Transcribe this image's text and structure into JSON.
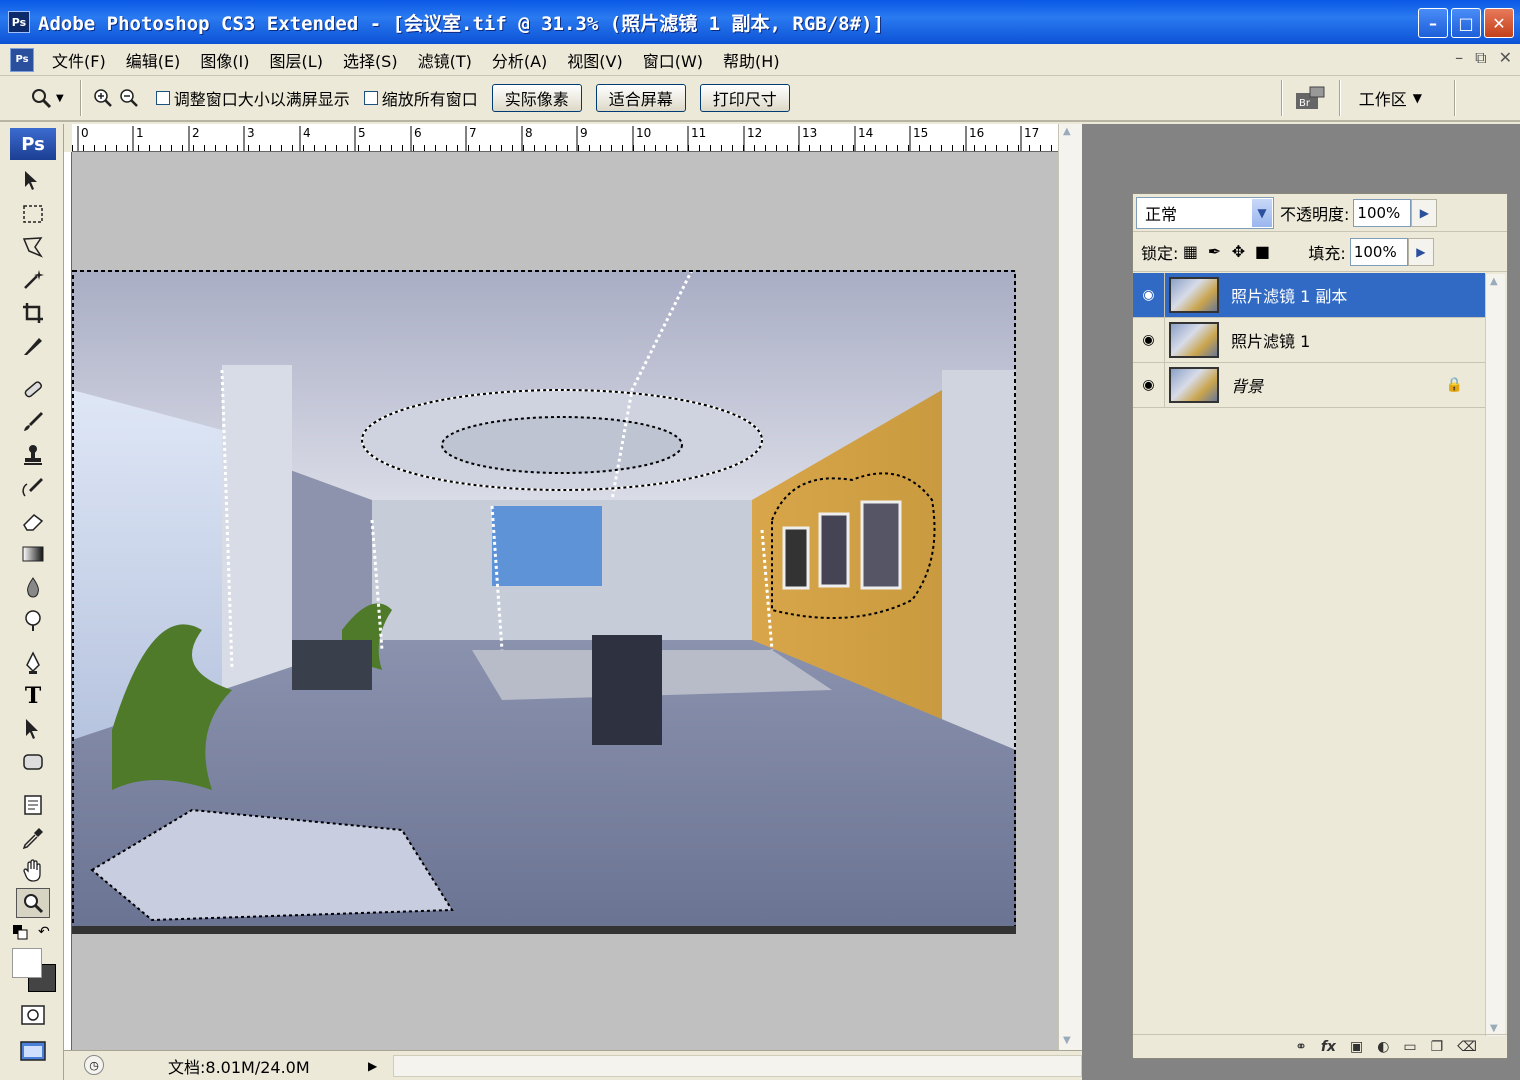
{
  "window": {
    "app_icon": "Ps",
    "title": "Adobe Photoshop CS3 Extended - [会议室.tif @ 31.3% (照片滤镜 1 副本, RGB/8#)]",
    "controls": [
      "minimize-icon",
      "maximize-icon",
      "close-icon"
    ]
  },
  "menu": {
    "doc_icon": "Ps",
    "items": [
      "文件(F)",
      "编辑(E)",
      "图像(I)",
      "图层(L)",
      "选择(S)",
      "滤镜(T)",
      "分析(A)",
      "视图(V)",
      "窗口(W)",
      "帮助(H)"
    ]
  },
  "options": {
    "resize_windows_label": "调整窗口大小以满屏显示",
    "zoom_all_label": "缩放所有窗口",
    "actual_pixels": "实际像素",
    "fit_screen": "适合屏幕",
    "print_size": "打印尺寸",
    "workspace_label": "工作区",
    "bridge_icon": "bridge-icon"
  },
  "toolbox": {
    "logo": "Ps",
    "tools": [
      "move-icon",
      "marquee-icon",
      "lasso-icon",
      "magic-wand-icon",
      "crop-icon",
      "slice-icon",
      "healing-brush-icon",
      "brush-icon",
      "clone-stamp-icon",
      "history-brush-icon",
      "eraser-icon",
      "gradient-icon",
      "blur-icon",
      "dodge-icon",
      "pen-icon",
      "type-icon",
      "path-selection-icon",
      "shape-icon",
      "notes-icon",
      "eyedropper-icon",
      "hand-icon",
      "zoom-icon"
    ],
    "active_tool": "zoom-icon"
  },
  "ruler": {
    "ticks": [
      "0",
      "1",
      "2",
      "3",
      "4",
      "5",
      "6",
      "7",
      "8",
      "9",
      "10",
      "11",
      "12",
      "13",
      "14",
      "15",
      "16",
      "17"
    ]
  },
  "document": {
    "status": "文档:8.01M/24.0M"
  },
  "layers_panel": {
    "blend_mode": "正常",
    "opacity_label": "不透明度:",
    "opacity_value": "100%",
    "lock_label": "锁定:",
    "fill_label": "填充:",
    "fill_value": "100%",
    "layers": [
      {
        "name": "照片滤镜 1 副本",
        "visible": true,
        "selected": true,
        "locked": false
      },
      {
        "name": "照片滤镜 1",
        "visible": true,
        "selected": false,
        "locked": false
      },
      {
        "name": "背景",
        "visible": true,
        "selected": false,
        "locked": true
      }
    ],
    "footer_icons": [
      "link-icon",
      "fx-icon",
      "mask-icon",
      "adjustment-icon",
      "folder-icon",
      "new-layer-icon",
      "trash-icon"
    ]
  },
  "colors": {
    "title_bar": "#0a58e6",
    "selected_layer": "#316ac5",
    "canvas_bg": "#c0c0c0",
    "gutter": "#838383"
  }
}
